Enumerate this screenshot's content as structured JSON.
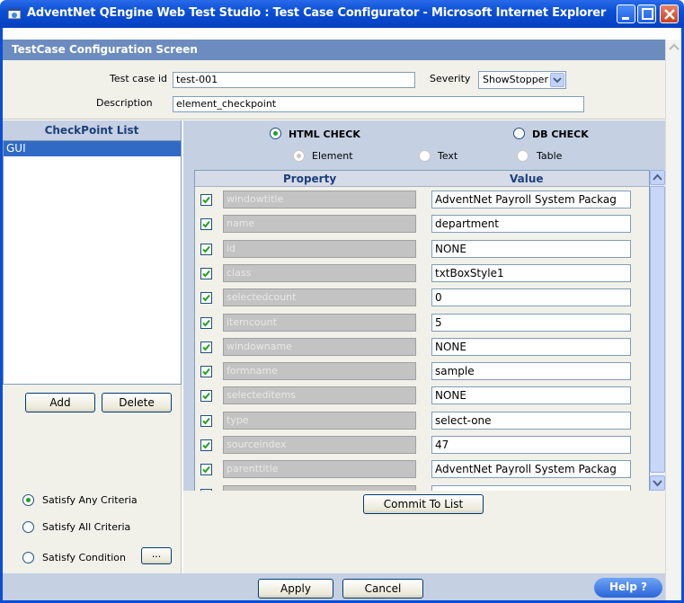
{
  "window": {
    "title": "AdventNet QEngine Web Test Studio : Test Case Configurator - Microsoft Internet Explorer"
  },
  "header": {
    "title": "TestCase Configuration Screen"
  },
  "form": {
    "testcase_label": "Test case id",
    "testcase_value": "test-001",
    "severity_label": "Severity",
    "severity_value": "ShowStopper",
    "description_label": "Description",
    "description_value": "element_checkpoint"
  },
  "checkpoints": {
    "header": "CheckPoint List",
    "items": [
      "GUI"
    ],
    "add_label": "Add",
    "delete_label": "Delete"
  },
  "criteria": {
    "options": [
      "Satisfy Any Criteria",
      "Satisfy All Criteria",
      "Satisfy Condition"
    ],
    "selected": "Satisfy Any Criteria",
    "condition_button": "..."
  },
  "check_type": {
    "options": [
      "HTML CHECK",
      "DB CHECK"
    ],
    "selected": "HTML CHECK",
    "sub_options": [
      "Element",
      "Text",
      "Table"
    ],
    "sub_selected": "Element"
  },
  "grid": {
    "col_property": "Property",
    "col_value": "Value",
    "rows": [
      {
        "property": "windowtitle",
        "value": "AdventNet Payroll System Packag"
      },
      {
        "property": "name",
        "value": "department"
      },
      {
        "property": "id",
        "value": "NONE"
      },
      {
        "property": "class",
        "value": "txtBoxStyle1"
      },
      {
        "property": "selectedcount",
        "value": "0"
      },
      {
        "property": "itemcount",
        "value": "5"
      },
      {
        "property": "windowname",
        "value": "NONE"
      },
      {
        "property": "formname",
        "value": "sample"
      },
      {
        "property": "selecteditems",
        "value": "NONE"
      },
      {
        "property": "type",
        "value": "select-one"
      },
      {
        "property": "sourceindex",
        "value": "47"
      },
      {
        "property": "parenttitle",
        "value": "AdventNet Payroll System Packag"
      }
    ]
  },
  "commit_label": "Commit To List",
  "footer": {
    "apply_label": "Apply",
    "cancel_label": "Cancel",
    "help_label": "Help ?"
  },
  "colors": {
    "titlebar": "#0a4fd6",
    "header": "#6c8cc0",
    "panel": "#c5d0e3",
    "selection": "#316ac5"
  }
}
